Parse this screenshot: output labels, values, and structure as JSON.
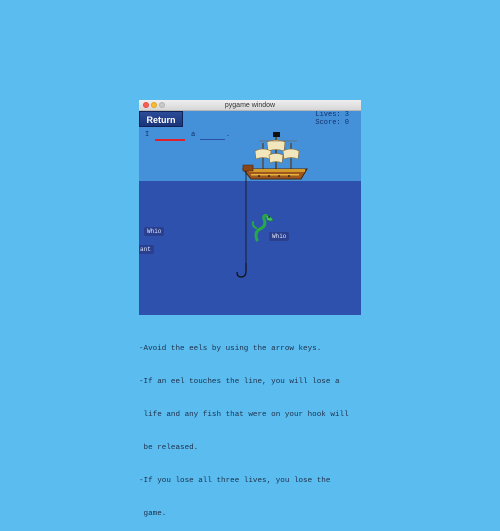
{
  "window": {
    "title": "pygame window"
  },
  "game": {
    "return_label": "Return",
    "lives": "Lives: 3",
    "score": "Score: 0",
    "phrase": {
      "start": "I",
      "middle": "a",
      "end": "."
    },
    "fish_labels": [
      "Whio",
      "Whio",
      "ant"
    ]
  },
  "instructions": [
    "-Avoid the eels by using the arrow keys.",
    "-If an eel touches the line, you will lose a",
    " life and any fish that were on your hook will",
    " be released.",
    "-If you lose all three lives, you lose the",
    " game."
  ],
  "colors": {
    "background": "#5bbcef",
    "sky": "#4591d9",
    "sea": "#2f51ae",
    "return_button": "#1f3b82",
    "blank_highlight": "#e0202c"
  }
}
